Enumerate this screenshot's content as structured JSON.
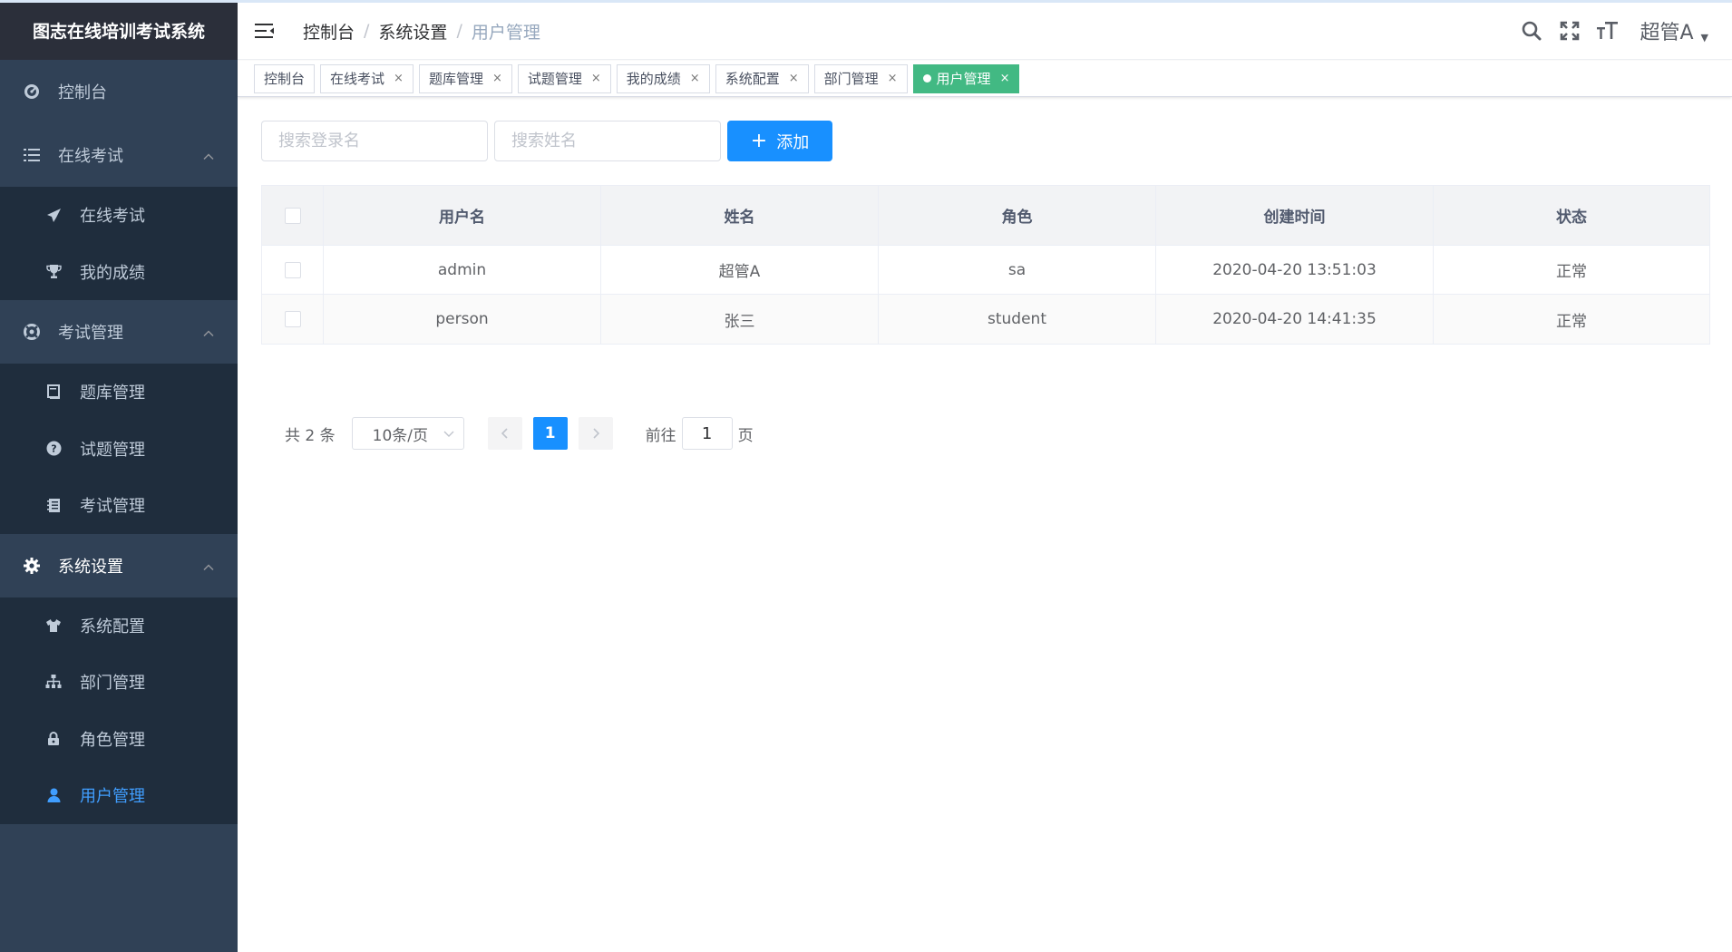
{
  "app": {
    "title": "图志在线培训考试系统"
  },
  "sidebar": {
    "items": [
      {
        "label": "控制台",
        "icon": "dashboard-icon"
      },
      {
        "label": "在线考试",
        "icon": "list-icon",
        "expanded": true,
        "children": [
          {
            "label": "在线考试",
            "icon": "paper-plane-icon"
          },
          {
            "label": "我的成绩",
            "icon": "trophy-icon"
          }
        ]
      },
      {
        "label": "考试管理",
        "icon": "lifebuoy-icon",
        "expanded": true,
        "children": [
          {
            "label": "题库管理",
            "icon": "book-icon"
          },
          {
            "label": "试题管理",
            "icon": "question-icon"
          },
          {
            "label": "考试管理",
            "icon": "notebook-icon"
          }
        ]
      },
      {
        "label": "系统设置",
        "icon": "gear-icon",
        "expanded": true,
        "children": [
          {
            "label": "系统配置",
            "icon": "shirt-icon"
          },
          {
            "label": "部门管理",
            "icon": "sitemap-icon"
          },
          {
            "label": "角色管理",
            "icon": "lock-icon"
          },
          {
            "label": "用户管理",
            "icon": "user-icon",
            "active": true
          }
        ]
      }
    ]
  },
  "header": {
    "breadcrumb": [
      "控制台",
      "系统设置",
      "用户管理"
    ],
    "separator": "/",
    "user_name": "超管A"
  },
  "tags": [
    {
      "label": "控制台",
      "closable": false
    },
    {
      "label": "在线考试",
      "closable": true
    },
    {
      "label": "题库管理",
      "closable": true
    },
    {
      "label": "试题管理",
      "closable": true
    },
    {
      "label": "我的成绩",
      "closable": true
    },
    {
      "label": "系统配置",
      "closable": true
    },
    {
      "label": "部门管理",
      "closable": true
    },
    {
      "label": "用户管理",
      "closable": true,
      "active": true
    }
  ],
  "filter": {
    "login_placeholder": "搜索登录名",
    "name_placeholder": "搜索姓名",
    "add_label": "添加"
  },
  "table": {
    "columns": [
      "用户名",
      "姓名",
      "角色",
      "创建时间",
      "状态"
    ],
    "rows": [
      [
        "admin",
        "超管A",
        "sa",
        "2020-04-20 13:51:03",
        "正常"
      ],
      [
        "person",
        "张三",
        "student",
        "2020-04-20 14:41:35",
        "正常"
      ]
    ]
  },
  "pagination": {
    "total_text": "共 2 条",
    "page_size": "10条/页",
    "current_page": "1",
    "goto_prefix": "前往",
    "goto_value": "1",
    "goto_suffix": "页"
  },
  "colors": {
    "sidebar_bg": "#304156",
    "submenu_bg": "#1f2d3d",
    "accent": "#1890ff",
    "active_tag": "#42b983",
    "active_menu_text": "#409eff"
  }
}
